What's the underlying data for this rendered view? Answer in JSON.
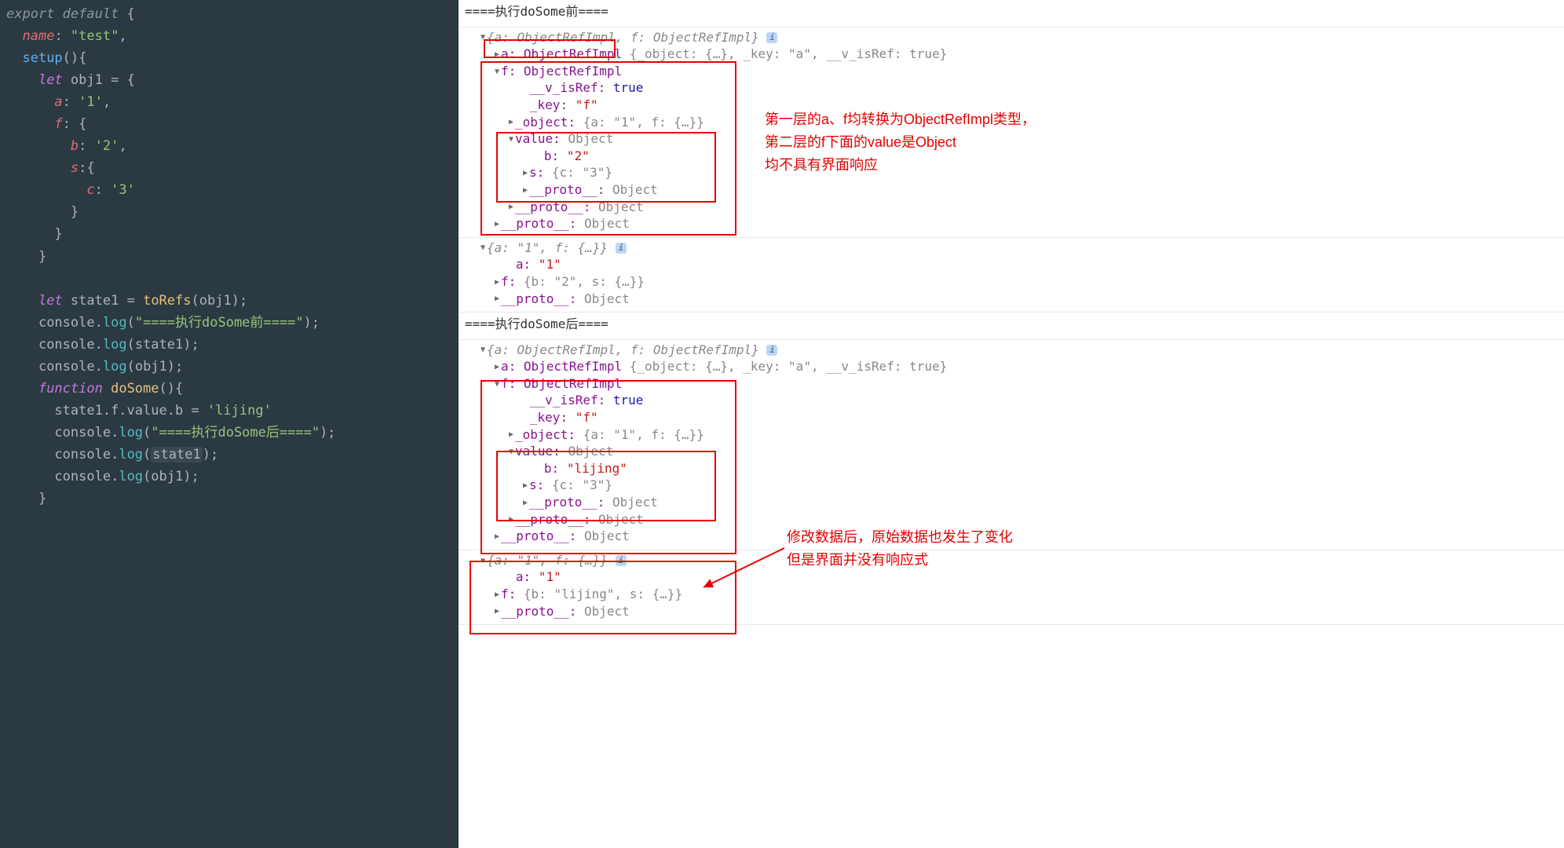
{
  "code": {
    "l1": "export default {",
    "l2_key": "name",
    "l2_val": "\"test\"",
    "l3": "setup",
    "l4_kw": "let",
    "l4_var": "obj1",
    "l5_key": "a",
    "l5_val": "'1'",
    "l6_key": "f",
    "l7_key": "b",
    "l7_val": "'2'",
    "l8_key": "s",
    "l9_key": "c",
    "l9_val": "'3'",
    "l14_kw": "let",
    "l14_var": "state1",
    "l14_fn": "toRefs",
    "l14_arg": "obj1",
    "l15_obj": "console",
    "l15_method": "log",
    "l15_str": "\"====执行doSome前====\"",
    "l16_arg": "state1",
    "l17_arg": "obj1",
    "l18_kw": "function",
    "l18_name": "doSome",
    "l19_lhs": "state1.f.value.b",
    "l19_rhs": "'lijing'",
    "l20_str": "\"====执行doSome后====\"",
    "l21_arg": "state1",
    "l22_arg": "obj1"
  },
  "console": {
    "header1": "====执行doSome前====",
    "header2": "====执行doSome后====",
    "summary1": "{a: ObjectRefImpl, f: ObjectRefImpl}",
    "a_line": "a: ObjectRefImpl",
    "a_detail": " {_object: {…}, _key: \"a\", __v_isRef: true}",
    "f_line": "f: ObjectRefImpl",
    "v_isref": "__v_isRef: ",
    "v_isref_val": "true",
    "key_lbl": "_key: ",
    "key_val": "\"f\"",
    "object_lbl": "_object: ",
    "object_val": "{a: \"1\", f: {…}}",
    "value_lbl": "value: ",
    "value_val": "Object",
    "b_lbl": "b: ",
    "b_val1": "\"2\"",
    "b_val2": "\"lijing\"",
    "s_lbl": "s: ",
    "s_val": "{c: \"3\"}",
    "proto_lbl": "__proto__: ",
    "proto_val": "Object",
    "summary2": "{a: \"1\", f: {…}}",
    "a2_lbl": "a: ",
    "a2_val": "\"1\"",
    "f2_lbl": "f: ",
    "f2_val1": "{b: \"2\", s: {…}}",
    "f2_val2": "{b: \"lijing\", s: {…}}"
  },
  "annotations": {
    "a1_line1": "第一层的a、f均转换为ObjectRefImpl类型，",
    "a1_line2": "第二层的f下面的value是Object",
    "a1_line3": "均不具有界面响应",
    "a2_line1": "修改数据后，原始数据也发生了变化",
    "a2_line2": "但是界面并没有响应式"
  }
}
